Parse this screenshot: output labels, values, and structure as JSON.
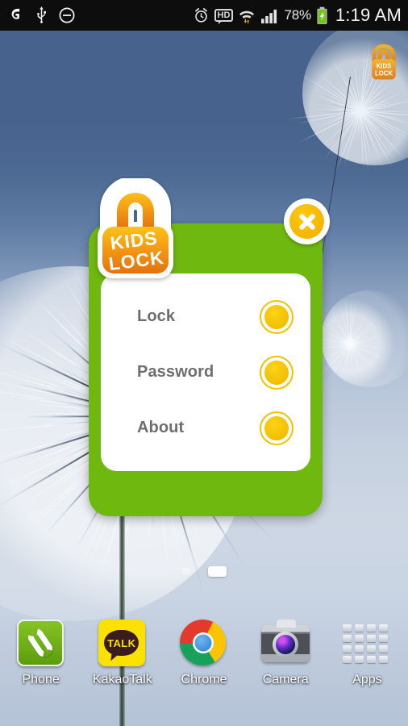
{
  "status_bar": {
    "left_icons": [
      {
        "name": "carrier-logo-icon",
        "glyph": "G"
      },
      {
        "name": "usb-icon",
        "glyph": "usb"
      },
      {
        "name": "do-not-disturb-icon",
        "glyph": "⊖"
      }
    ],
    "right_icons": [
      {
        "name": "alarm-clock-icon",
        "glyph": "alarm"
      },
      {
        "name": "hd-voice-icon",
        "glyph": "HD"
      },
      {
        "name": "wifi-transfer-icon",
        "glyph": "wifi"
      },
      {
        "name": "signal-bars-icon",
        "glyph": "signal"
      }
    ],
    "battery_percent": "78%",
    "battery_state": "charging",
    "time": "1:19 AM"
  },
  "home": {
    "widget_label_line1": "KIDS",
    "widget_label_line2": "LOCK",
    "page_indicator": {
      "pages": 2,
      "active_index": 1
    }
  },
  "dialog": {
    "logo_line1": "KIDS",
    "logo_line2": "LOCK",
    "close_label": "Close",
    "accent_green": "#6fb80f",
    "accent_yellow": "#f3c000",
    "accent_orange": "#f29a0e",
    "items": [
      {
        "label": "Lock",
        "button": "lock-option-button"
      },
      {
        "label": "Password",
        "button": "password-option-button"
      },
      {
        "label": "About",
        "button": "about-option-button"
      }
    ]
  },
  "dock": {
    "items": [
      {
        "label": "Phone",
        "icon": "phone-icon"
      },
      {
        "label": "KakaoTalk",
        "icon": "kakaotalk-icon",
        "badge_text": "TALK"
      },
      {
        "label": "Chrome",
        "icon": "chrome-icon"
      },
      {
        "label": "Camera",
        "icon": "camera-icon"
      },
      {
        "label": "Apps",
        "icon": "apps-grid-icon"
      }
    ]
  }
}
